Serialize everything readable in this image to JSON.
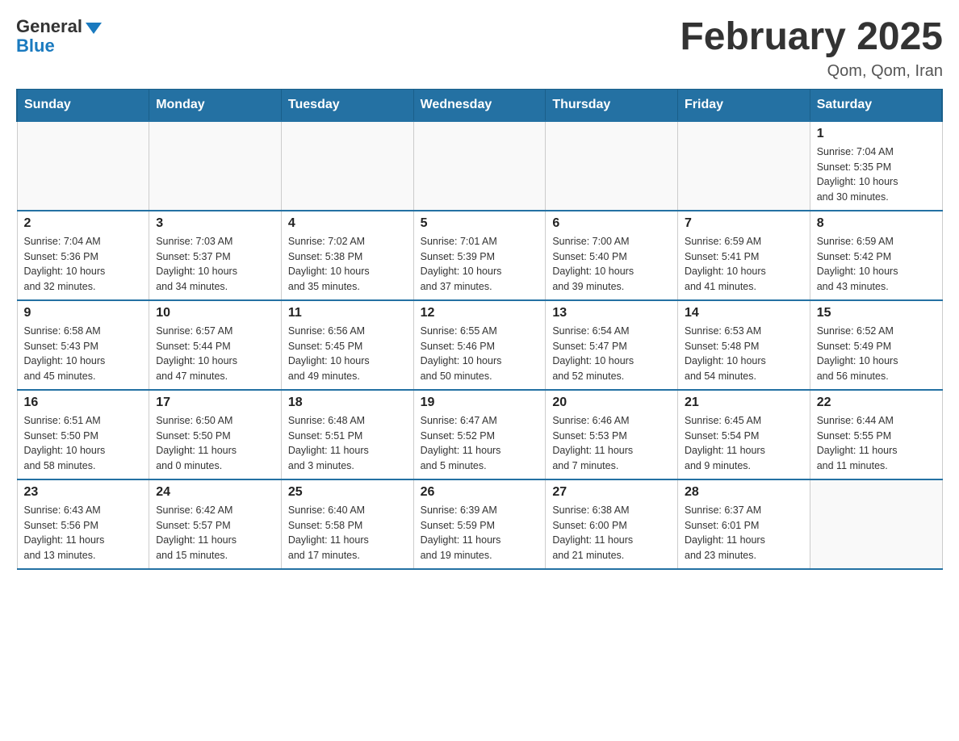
{
  "header": {
    "logo_general": "General",
    "logo_blue": "Blue",
    "month_title": "February 2025",
    "location": "Qom, Qom, Iran"
  },
  "weekdays": [
    "Sunday",
    "Monday",
    "Tuesday",
    "Wednesday",
    "Thursday",
    "Friday",
    "Saturday"
  ],
  "weeks": [
    [
      {
        "day": "",
        "info": ""
      },
      {
        "day": "",
        "info": ""
      },
      {
        "day": "",
        "info": ""
      },
      {
        "day": "",
        "info": ""
      },
      {
        "day": "",
        "info": ""
      },
      {
        "day": "",
        "info": ""
      },
      {
        "day": "1",
        "info": "Sunrise: 7:04 AM\nSunset: 5:35 PM\nDaylight: 10 hours\nand 30 minutes."
      }
    ],
    [
      {
        "day": "2",
        "info": "Sunrise: 7:04 AM\nSunset: 5:36 PM\nDaylight: 10 hours\nand 32 minutes."
      },
      {
        "day": "3",
        "info": "Sunrise: 7:03 AM\nSunset: 5:37 PM\nDaylight: 10 hours\nand 34 minutes."
      },
      {
        "day": "4",
        "info": "Sunrise: 7:02 AM\nSunset: 5:38 PM\nDaylight: 10 hours\nand 35 minutes."
      },
      {
        "day": "5",
        "info": "Sunrise: 7:01 AM\nSunset: 5:39 PM\nDaylight: 10 hours\nand 37 minutes."
      },
      {
        "day": "6",
        "info": "Sunrise: 7:00 AM\nSunset: 5:40 PM\nDaylight: 10 hours\nand 39 minutes."
      },
      {
        "day": "7",
        "info": "Sunrise: 6:59 AM\nSunset: 5:41 PM\nDaylight: 10 hours\nand 41 minutes."
      },
      {
        "day": "8",
        "info": "Sunrise: 6:59 AM\nSunset: 5:42 PM\nDaylight: 10 hours\nand 43 minutes."
      }
    ],
    [
      {
        "day": "9",
        "info": "Sunrise: 6:58 AM\nSunset: 5:43 PM\nDaylight: 10 hours\nand 45 minutes."
      },
      {
        "day": "10",
        "info": "Sunrise: 6:57 AM\nSunset: 5:44 PM\nDaylight: 10 hours\nand 47 minutes."
      },
      {
        "day": "11",
        "info": "Sunrise: 6:56 AM\nSunset: 5:45 PM\nDaylight: 10 hours\nand 49 minutes."
      },
      {
        "day": "12",
        "info": "Sunrise: 6:55 AM\nSunset: 5:46 PM\nDaylight: 10 hours\nand 50 minutes."
      },
      {
        "day": "13",
        "info": "Sunrise: 6:54 AM\nSunset: 5:47 PM\nDaylight: 10 hours\nand 52 minutes."
      },
      {
        "day": "14",
        "info": "Sunrise: 6:53 AM\nSunset: 5:48 PM\nDaylight: 10 hours\nand 54 minutes."
      },
      {
        "day": "15",
        "info": "Sunrise: 6:52 AM\nSunset: 5:49 PM\nDaylight: 10 hours\nand 56 minutes."
      }
    ],
    [
      {
        "day": "16",
        "info": "Sunrise: 6:51 AM\nSunset: 5:50 PM\nDaylight: 10 hours\nand 58 minutes."
      },
      {
        "day": "17",
        "info": "Sunrise: 6:50 AM\nSunset: 5:50 PM\nDaylight: 11 hours\nand 0 minutes."
      },
      {
        "day": "18",
        "info": "Sunrise: 6:48 AM\nSunset: 5:51 PM\nDaylight: 11 hours\nand 3 minutes."
      },
      {
        "day": "19",
        "info": "Sunrise: 6:47 AM\nSunset: 5:52 PM\nDaylight: 11 hours\nand 5 minutes."
      },
      {
        "day": "20",
        "info": "Sunrise: 6:46 AM\nSunset: 5:53 PM\nDaylight: 11 hours\nand 7 minutes."
      },
      {
        "day": "21",
        "info": "Sunrise: 6:45 AM\nSunset: 5:54 PM\nDaylight: 11 hours\nand 9 minutes."
      },
      {
        "day": "22",
        "info": "Sunrise: 6:44 AM\nSunset: 5:55 PM\nDaylight: 11 hours\nand 11 minutes."
      }
    ],
    [
      {
        "day": "23",
        "info": "Sunrise: 6:43 AM\nSunset: 5:56 PM\nDaylight: 11 hours\nand 13 minutes."
      },
      {
        "day": "24",
        "info": "Sunrise: 6:42 AM\nSunset: 5:57 PM\nDaylight: 11 hours\nand 15 minutes."
      },
      {
        "day": "25",
        "info": "Sunrise: 6:40 AM\nSunset: 5:58 PM\nDaylight: 11 hours\nand 17 minutes."
      },
      {
        "day": "26",
        "info": "Sunrise: 6:39 AM\nSunset: 5:59 PM\nDaylight: 11 hours\nand 19 minutes."
      },
      {
        "day": "27",
        "info": "Sunrise: 6:38 AM\nSunset: 6:00 PM\nDaylight: 11 hours\nand 21 minutes."
      },
      {
        "day": "28",
        "info": "Sunrise: 6:37 AM\nSunset: 6:01 PM\nDaylight: 11 hours\nand 23 minutes."
      },
      {
        "day": "",
        "info": ""
      }
    ]
  ]
}
